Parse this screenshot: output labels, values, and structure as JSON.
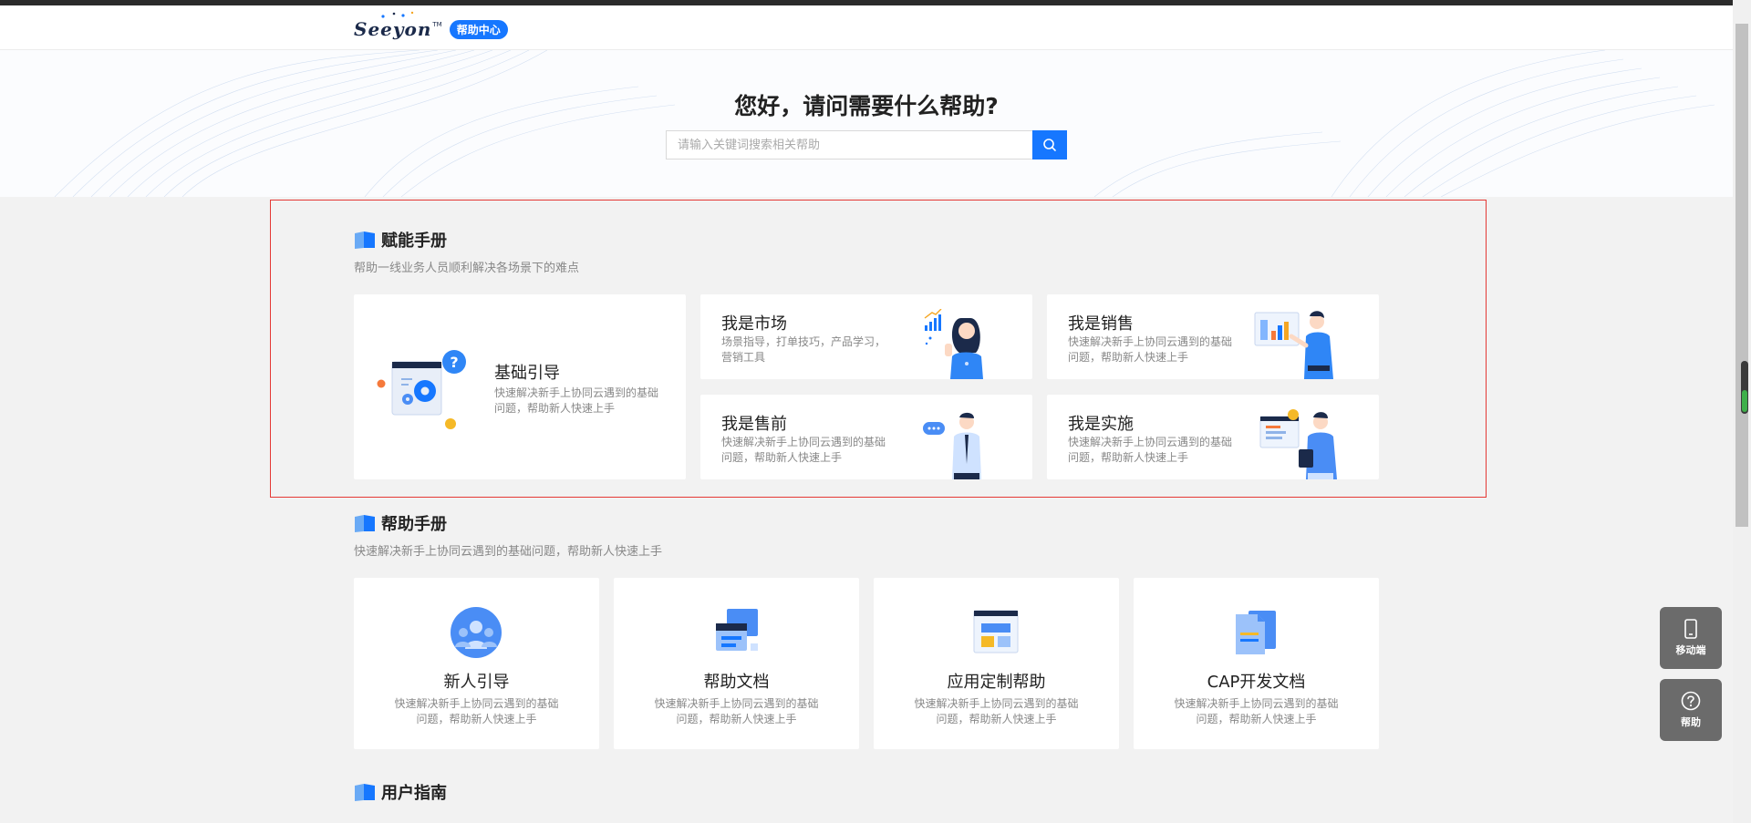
{
  "header": {
    "logo_text": "Seeyon",
    "logo_tm": "TM",
    "badge": "帮助中心"
  },
  "hero": {
    "title": "您好，请问需要什么帮助?",
    "search_placeholder": "请输入关键词搜索相关帮助",
    "search_value": ""
  },
  "empower": {
    "title": "赋能手册",
    "subtitle": "帮助一线业务人员顺利解决各场景下的难点",
    "main_card": {
      "title": "基础引导",
      "desc_line1": "快速解决新手上协同云遇到的基础",
      "desc_line2": "问题，帮助新人快速上手"
    },
    "cards": [
      {
        "title": "我是市场",
        "desc_line1": "场景指导，打单技巧，产品学习，",
        "desc_line2": "营销工具"
      },
      {
        "title": "我是销售",
        "desc_line1": "快速解决新手上协同云遇到的基础",
        "desc_line2": "问题，帮助新人快速上手"
      },
      {
        "title": "我是售前",
        "desc_line1": "快速解决新手上协同云遇到的基础",
        "desc_line2": "问题，帮助新人快速上手"
      },
      {
        "title": "我是实施",
        "desc_line1": "快速解决新手上协同云遇到的基础",
        "desc_line2": "问题，帮助新人快速上手"
      }
    ]
  },
  "help_manual": {
    "title": "帮助手册",
    "subtitle": "快速解决新手上协同云遇到的基础问题，帮助新人快速上手",
    "cards": [
      {
        "title": "新人引导",
        "desc_line1": "快速解决新手上协同云遇到的基础",
        "desc_line2": "问题，帮助新人快速上手"
      },
      {
        "title": "帮助文档",
        "desc_line1": "快速解决新手上协同云遇到的基础",
        "desc_line2": "问题，帮助新人快速上手"
      },
      {
        "title": "应用定制帮助",
        "desc_line1": "快速解决新手上协同云遇到的基础",
        "desc_line2": "问题，帮助新人快速上手"
      },
      {
        "title": "CAP开发文档",
        "desc_line1": "快速解决新手上协同云遇到的基础",
        "desc_line2": "问题，帮助新人快速上手"
      }
    ]
  },
  "user_guide": {
    "title": "用户指南"
  },
  "float": {
    "mobile_label": "移动端",
    "help_label": "帮助"
  },
  "colors": {
    "accent": "#1677ff",
    "outline": "#e53935",
    "float_bg": "#6b6b6b"
  }
}
